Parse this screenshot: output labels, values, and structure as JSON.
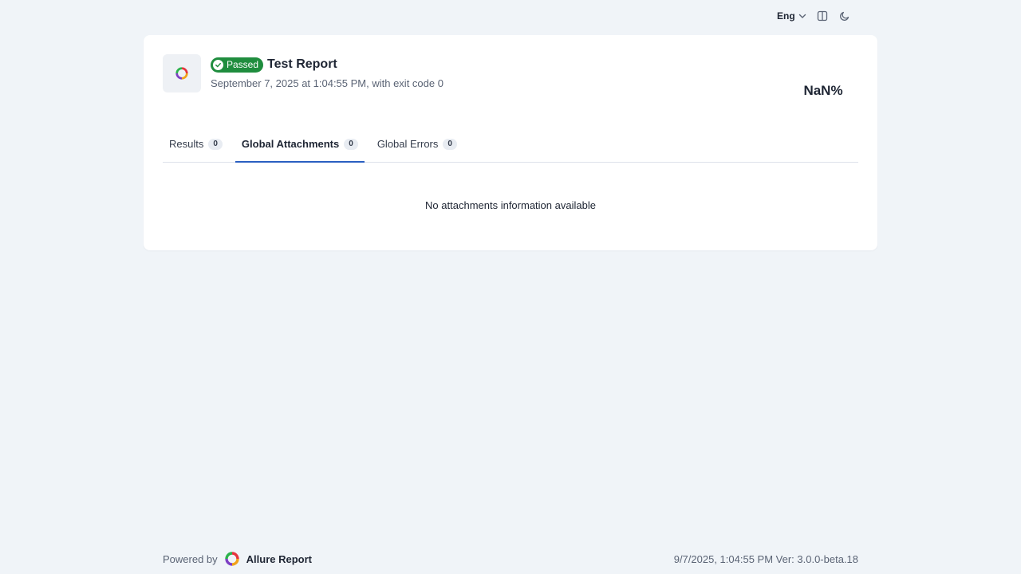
{
  "topbar": {
    "language": "Eng",
    "layout_icon": "layout-split-icon",
    "theme_icon": "moon-icon"
  },
  "header": {
    "status_badge": "Passed",
    "title": "Test Report",
    "subtitle": "September 7, 2025 at 1:04:55 PM, with exit code 0",
    "percent": "NaN%"
  },
  "tabs": [
    {
      "label": "Results",
      "count": "0"
    },
    {
      "label": "Global Attachments",
      "count": "0",
      "active": true
    },
    {
      "label": "Global Errors",
      "count": "0"
    }
  ],
  "main": {
    "empty_message": "No attachments information available"
  },
  "footer": {
    "powered_by": "Powered by",
    "brand": "Allure Report",
    "meta": "9/7/2025, 1:04:55 PM Ver: 3.0.0-beta.18"
  },
  "colors": {
    "background": "#f0f4f8",
    "passed": "#1f8d3e",
    "accent": "#2a5fc1"
  }
}
